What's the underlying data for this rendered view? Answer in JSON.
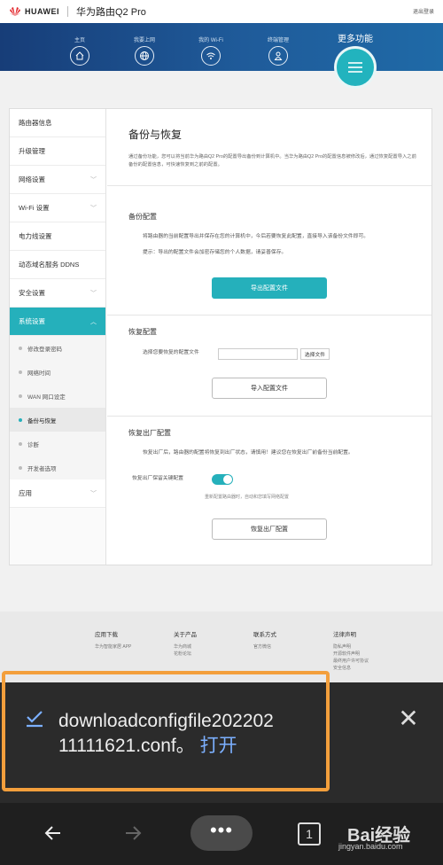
{
  "header": {
    "brand": "HUAWEI",
    "product": "华为路由Q2 Pro",
    "exit": "退出登录"
  },
  "nav": {
    "items": [
      {
        "label": "主页",
        "icon": "home-icon"
      },
      {
        "label": "我要上网",
        "icon": "globe-icon"
      },
      {
        "label": "我的 Wi-Fi",
        "icon": "wifi-icon"
      },
      {
        "label": "终端管理",
        "icon": "user-icon"
      }
    ],
    "more": "更多功能"
  },
  "sidebar": {
    "items": [
      "路由器信息",
      "升级管理",
      "网络设置",
      "Wi-Fi 设置",
      "电力线设置",
      "动态域名服务 DDNS",
      "安全设置",
      "系统设置"
    ],
    "sub": [
      "修改登录密码",
      "网络时间",
      "WAN 网口设定",
      "备份与恢复",
      "诊断",
      "开发者选项"
    ],
    "last": "应用"
  },
  "main": {
    "title": "备份与恢复",
    "desc": "通过备份功能，您可以将当前华为路由Q2 Pro的配置导出备份到计算机中。当华为路由Q2 Pro的配置信息被修改后，通过恢复配置导入之前备份的配置信息，可快速恢复到之前的配置。",
    "backup": {
      "title": "备份配置",
      "text1": "将路由器的当前配置导出并保存在您的计算机中，今后若要恢复此配置，直接导入该备份文件即可。",
      "text2": "提示：导出的配置文件会加密存储您的个人数据，请妥善保存。",
      "button": "导出配置文件"
    },
    "restore": {
      "title": "恢复配置",
      "label": "选择您要恢复的配置文件",
      "choose": "选择文件",
      "button": "导入配置文件"
    },
    "factory": {
      "title": "恢复出厂配置",
      "text": "恢复出厂后，路由器的配置将恢复到出厂状态，请慎用！建议您在恢复出厂前备份当前配置。",
      "toggle_label": "恢复出厂保留关键配置",
      "toggle_note": "重新配置路由器时，自动和您填写网络配置",
      "button": "恢复出厂配置"
    }
  },
  "footer": {
    "cols": [
      {
        "title": "应用下载",
        "links": [
          "华为智能家居 APP"
        ]
      },
      {
        "title": "关于产品",
        "links": [
          "华为商城",
          "花粉论坛"
        ]
      },
      {
        "title": "联系方式",
        "links": [
          "官方微信"
        ]
      },
      {
        "title": "法律声明",
        "links": [
          "隐私声明",
          "开源软件声明",
          "最终用户许可协议",
          "安全信息"
        ]
      }
    ]
  },
  "download": {
    "filename": "downloadconfigfile20220211111621.conf。",
    "open": "打开"
  },
  "browser": {
    "tabs": "1"
  },
  "watermark": {
    "text": "Bai经验",
    "url": "jingyan.baidu.com"
  },
  "colors": {
    "accent": "#25b0bb",
    "nav": "#1f5b9a",
    "highlight": "#f39f3c"
  }
}
